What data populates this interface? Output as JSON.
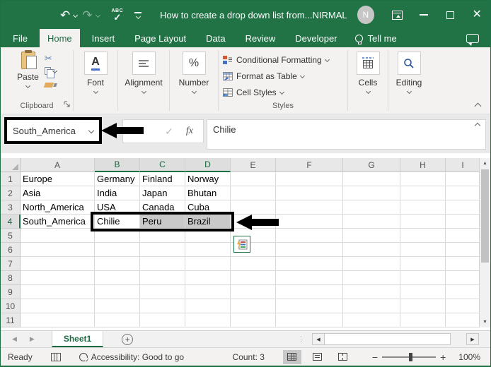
{
  "titlebar": {
    "title": "How to create a drop down list from...",
    "user_name": "NIRMAL",
    "avatar_initial": "N",
    "spell_check_label": "ABC"
  },
  "icons": {
    "undo": "↶",
    "redo": "↷",
    "check": "✓",
    "scissors": "✂",
    "percent": "%",
    "font_letter": "A",
    "up": "▲",
    "down": "▼",
    "left": "◀",
    "right": "▶",
    "dots": "⋮",
    "bolt": "⚡",
    "close": "✕",
    "minus": "−",
    "plus": "+",
    "add": "+"
  },
  "tabs": {
    "items": [
      "File",
      "Home",
      "Insert",
      "Page Layout",
      "Data",
      "Review",
      "Developer"
    ],
    "active": "Home",
    "tell_me": "Tell me"
  },
  "ribbon": {
    "paste": "Paste",
    "clipboard_group": "Clipboard",
    "font": "Font",
    "alignment": "Alignment",
    "number": "Number",
    "conditional_formatting": "Conditional Formatting",
    "format_as_table": "Format as Table",
    "cell_styles": "Cell Styles",
    "styles_group": "Styles",
    "cells": "Cells",
    "editing": "Editing"
  },
  "formula_bar": {
    "name_box_value": "South_America",
    "fx_label": "fx",
    "value": "Chilie"
  },
  "sheet": {
    "col_headers": [
      "A",
      "B",
      "C",
      "D",
      "E",
      "F",
      "G",
      "H",
      "I"
    ],
    "row_count": 11,
    "cells": {
      "1": {
        "A": "Europe",
        "B": "Germany",
        "C": "Finland",
        "D": "Norway"
      },
      "2": {
        "A": "Asia",
        "B": "India",
        "C": "Japan",
        "D": "Bhutan"
      },
      "3": {
        "A": "North_America",
        "B": "USA",
        "C": "Canada",
        "D": "Cuba"
      },
      "4": {
        "A": "South_America",
        "B": "Chilie",
        "C": "Peru",
        "D": "Brazil"
      }
    },
    "selection": {
      "active_cell": "B4",
      "selected_cells": [
        "C4",
        "D4"
      ],
      "highlighted_cols": [
        "B",
        "C",
        "D"
      ],
      "highlighted_row": "4"
    }
  },
  "sheet_tabs": {
    "active": "Sheet1"
  },
  "status_bar": {
    "mode": "Ready",
    "accessibility": "Accessibility: Good to go",
    "count": "Count: 3",
    "zoom_level": "100%"
  },
  "colors": {
    "excel_green": "#217346",
    "header_highlight_green": "#1e7145",
    "selection_gray": "#c9c9c9",
    "annotation_black": "#000000"
  }
}
